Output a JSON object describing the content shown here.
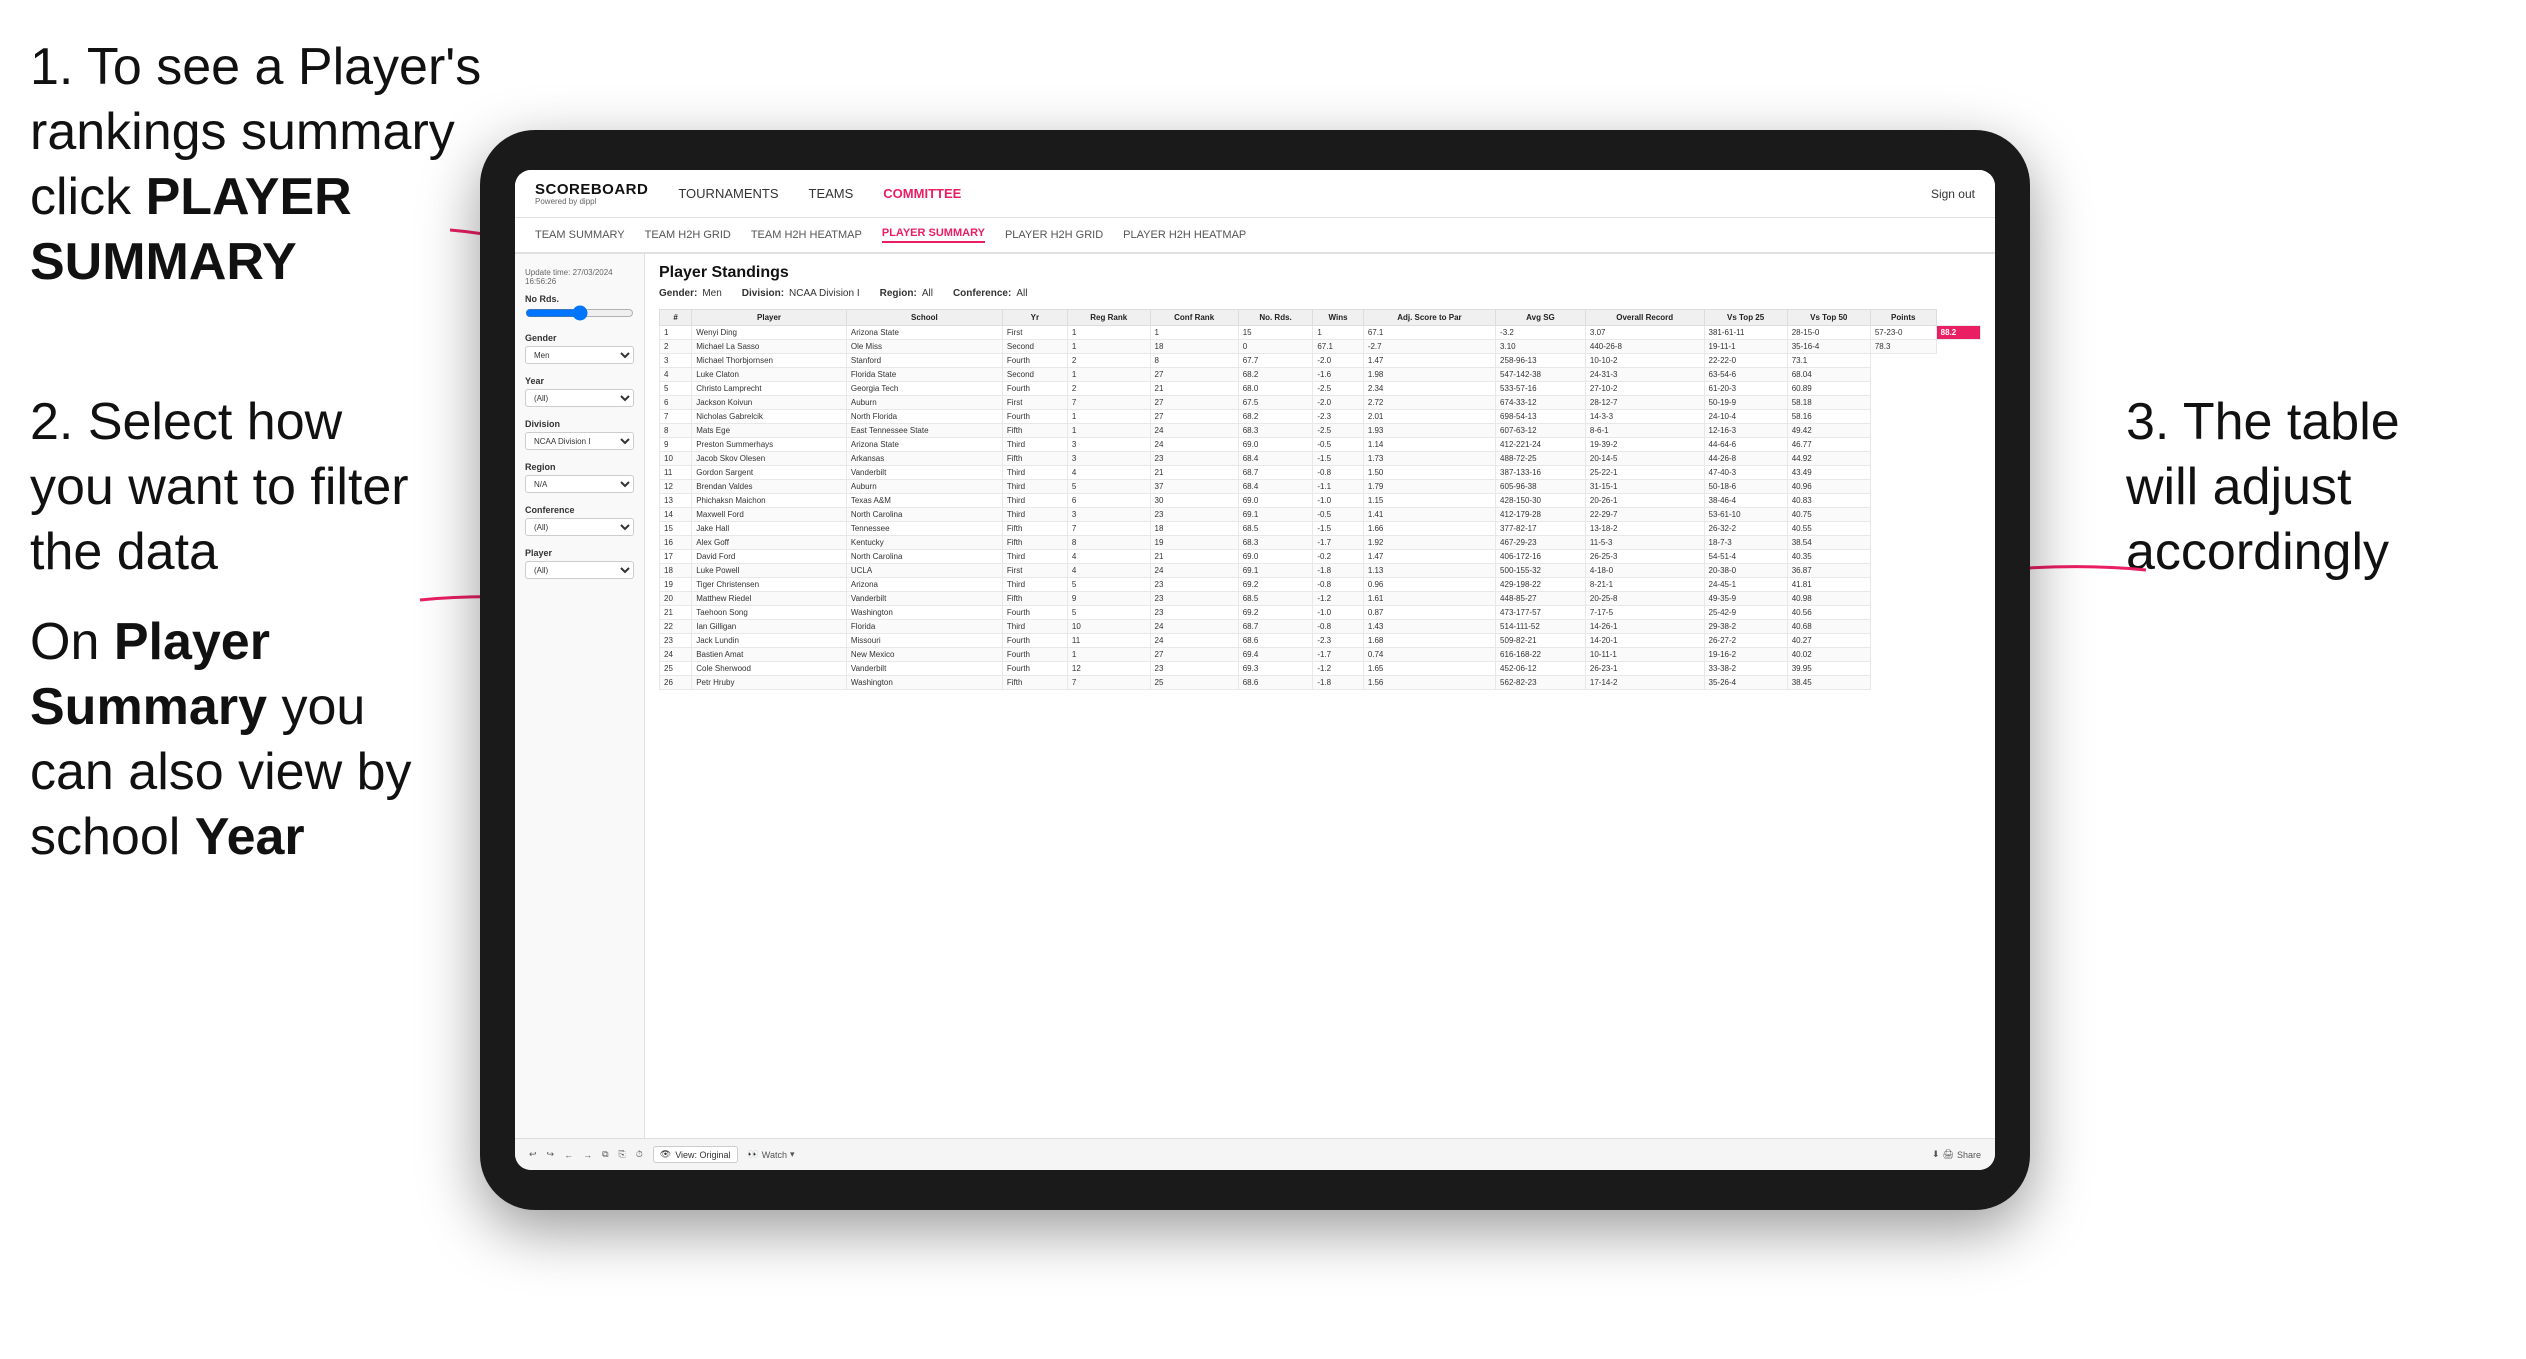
{
  "instructions": {
    "step1": {
      "text": "1. To see a Player's rankings summary click ",
      "bold": "PLAYER SUMMARY"
    },
    "step2": {
      "text": "2. Select how you want to filter the data"
    },
    "step3": {
      "text": "3. The table will adjust accordingly"
    },
    "bottom": {
      "text": "On ",
      "bold1": "Player Summary",
      "text2": " you can also view by school ",
      "bold2": "Year"
    }
  },
  "app": {
    "logo": "SCOREBOARD",
    "logo_sub": "Powered by dippl",
    "nav": [
      "TOURNAMENTS",
      "TEAMS",
      "COMMITTEE"
    ],
    "nav_active": "COMMITTEE",
    "sign_in": "Sign out"
  },
  "subnav": {
    "items": [
      "TEAM SUMMARY",
      "TEAM H2H GRID",
      "TEAM H2H HEATMAP",
      "PLAYER SUMMARY",
      "PLAYER H2H GRID",
      "PLAYER H2H HEATMAP"
    ],
    "active": "PLAYER SUMMARY"
  },
  "sidebar": {
    "update_time": "Update time: 27/03/2024 16:56:26",
    "no_rds_label": "No Rds.",
    "gender_label": "Gender",
    "gender_value": "Men",
    "year_label": "Year",
    "year_value": "(All)",
    "division_label": "Division",
    "division_value": "NCAA Division I",
    "region_label": "Region",
    "region_value": "N/A",
    "conference_label": "Conference",
    "conference_value": "(All)",
    "player_label": "Player",
    "player_value": "(All)"
  },
  "table": {
    "title": "Player Standings",
    "gender_label": "Gender:",
    "gender_value": "Men",
    "division_label": "Division:",
    "division_value": "NCAA Division I",
    "region_label": "Region:",
    "region_value": "All",
    "conference_label": "Conference:",
    "conference_value": "All",
    "columns": [
      "#",
      "Player",
      "School",
      "Yr",
      "Reg Rank",
      "Conf Rank",
      "No. Rds.",
      "Wins",
      "Adj. Score to Par",
      "Avg SG",
      "Overall Record",
      "Vs Top 25",
      "Vs Top 50",
      "Points"
    ],
    "rows": [
      [
        "1",
        "Wenyi Ding",
        "Arizona State",
        "First",
        "1",
        "1",
        "15",
        "1",
        "67.1",
        "-3.2",
        "3.07",
        "381-61-11",
        "28-15-0",
        "57-23-0",
        "88.2"
      ],
      [
        "2",
        "Michael La Sasso",
        "Ole Miss",
        "Second",
        "1",
        "18",
        "0",
        "67.1",
        "-2.7",
        "3.10",
        "440-26-8",
        "19-11-1",
        "35-16-4",
        "78.3"
      ],
      [
        "3",
        "Michael Thorbjornsen",
        "Stanford",
        "Fourth",
        "2",
        "8",
        "67.7",
        "-2.0",
        "1.47",
        "258-96-13",
        "10-10-2",
        "22-22-0",
        "73.1"
      ],
      [
        "4",
        "Luke Claton",
        "Florida State",
        "Second",
        "1",
        "27",
        "68.2",
        "-1.6",
        "1.98",
        "547-142-38",
        "24-31-3",
        "63-54-6",
        "68.04"
      ],
      [
        "5",
        "Christo Lamprecht",
        "Georgia Tech",
        "Fourth",
        "2",
        "21",
        "68.0",
        "-2.5",
        "2.34",
        "533-57-16",
        "27-10-2",
        "61-20-3",
        "60.89"
      ],
      [
        "6",
        "Jackson Koivun",
        "Auburn",
        "First",
        "7",
        "27",
        "67.5",
        "-2.0",
        "2.72",
        "674-33-12",
        "28-12-7",
        "50-19-9",
        "58.18"
      ],
      [
        "7",
        "Nicholas Gabrelcik",
        "North Florida",
        "Fourth",
        "1",
        "27",
        "68.2",
        "-2.3",
        "2.01",
        "698-54-13",
        "14-3-3",
        "24-10-4",
        "58.16"
      ],
      [
        "8",
        "Mats Ege",
        "East Tennessee State",
        "Fifth",
        "1",
        "24",
        "68.3",
        "-2.5",
        "1.93",
        "607-63-12",
        "8-6-1",
        "12-16-3",
        "49.42"
      ],
      [
        "9",
        "Preston Summerhays",
        "Arizona State",
        "Third",
        "3",
        "24",
        "69.0",
        "-0.5",
        "1.14",
        "412-221-24",
        "19-39-2",
        "44-64-6",
        "46.77"
      ],
      [
        "10",
        "Jacob Skov Olesen",
        "Arkansas",
        "Fifth",
        "3",
        "23",
        "68.4",
        "-1.5",
        "1.73",
        "488-72-25",
        "20-14-5",
        "44-26-8",
        "44.92"
      ],
      [
        "11",
        "Gordon Sargent",
        "Vanderbilt",
        "Third",
        "4",
        "21",
        "68.7",
        "-0.8",
        "1.50",
        "387-133-16",
        "25-22-1",
        "47-40-3",
        "43.49"
      ],
      [
        "12",
        "Brendan Valdes",
        "Auburn",
        "Third",
        "5",
        "37",
        "68.4",
        "-1.1",
        "1.79",
        "605-96-38",
        "31-15-1",
        "50-18-6",
        "40.96"
      ],
      [
        "13",
        "Phichaksn Maichon",
        "Texas A&M",
        "Third",
        "6",
        "30",
        "69.0",
        "-1.0",
        "1.15",
        "428-150-30",
        "20-26-1",
        "38-46-4",
        "40.83"
      ],
      [
        "14",
        "Maxwell Ford",
        "North Carolina",
        "Third",
        "3",
        "23",
        "69.1",
        "-0.5",
        "1.41",
        "412-179-28",
        "22-29-7",
        "53-61-10",
        "40.75"
      ],
      [
        "15",
        "Jake Hall",
        "Tennessee",
        "Fifth",
        "7",
        "18",
        "68.5",
        "-1.5",
        "1.66",
        "377-82-17",
        "13-18-2",
        "26-32-2",
        "40.55"
      ],
      [
        "16",
        "Alex Goff",
        "Kentucky",
        "Fifth",
        "8",
        "19",
        "68.3",
        "-1.7",
        "1.92",
        "467-29-23",
        "11-5-3",
        "18-7-3",
        "38.54"
      ],
      [
        "17",
        "David Ford",
        "North Carolina",
        "Third",
        "4",
        "21",
        "69.0",
        "-0.2",
        "1.47",
        "406-172-16",
        "26-25-3",
        "54-51-4",
        "40.35"
      ],
      [
        "18",
        "Luke Powell",
        "UCLA",
        "First",
        "4",
        "24",
        "69.1",
        "-1.8",
        "1.13",
        "500-155-32",
        "4-18-0",
        "20-38-0",
        "36.87"
      ],
      [
        "19",
        "Tiger Christensen",
        "Arizona",
        "Third",
        "5",
        "23",
        "69.2",
        "-0.8",
        "0.96",
        "429-198-22",
        "8-21-1",
        "24-45-1",
        "41.81"
      ],
      [
        "20",
        "Matthew Riedel",
        "Vanderbilt",
        "Fifth",
        "9",
        "23",
        "68.5",
        "-1.2",
        "1.61",
        "448-85-27",
        "20-25-8",
        "49-35-9",
        "40.98"
      ],
      [
        "21",
        "Taehoon Song",
        "Washington",
        "Fourth",
        "5",
        "23",
        "69.2",
        "-1.0",
        "0.87",
        "473-177-57",
        "7-17-5",
        "25-42-9",
        "40.56"
      ],
      [
        "22",
        "Ian Gilligan",
        "Florida",
        "Third",
        "10",
        "24",
        "68.7",
        "-0.8",
        "1.43",
        "514-111-52",
        "14-26-1",
        "29-38-2",
        "40.68"
      ],
      [
        "23",
        "Jack Lundin",
        "Missouri",
        "Fourth",
        "11",
        "24",
        "68.6",
        "-2.3",
        "1.68",
        "509-82-21",
        "14-20-1",
        "26-27-2",
        "40.27"
      ],
      [
        "24",
        "Bastien Amat",
        "New Mexico",
        "Fourth",
        "1",
        "27",
        "69.4",
        "-1.7",
        "0.74",
        "616-168-22",
        "10-11-1",
        "19-16-2",
        "40.02"
      ],
      [
        "25",
        "Cole Sherwood",
        "Vanderbilt",
        "Fourth",
        "12",
        "23",
        "69.3",
        "-1.2",
        "1.65",
        "452-06-12",
        "26-23-1",
        "33-38-2",
        "39.95"
      ],
      [
        "26",
        "Petr Hruby",
        "Washington",
        "Fifth",
        "7",
        "25",
        "68.6",
        "-1.8",
        "1.56",
        "562-82-23",
        "17-14-2",
        "35-26-4",
        "38.45"
      ]
    ]
  },
  "toolbar": {
    "view_label": "View: Original",
    "watch_label": "Watch",
    "share_label": "Share"
  }
}
